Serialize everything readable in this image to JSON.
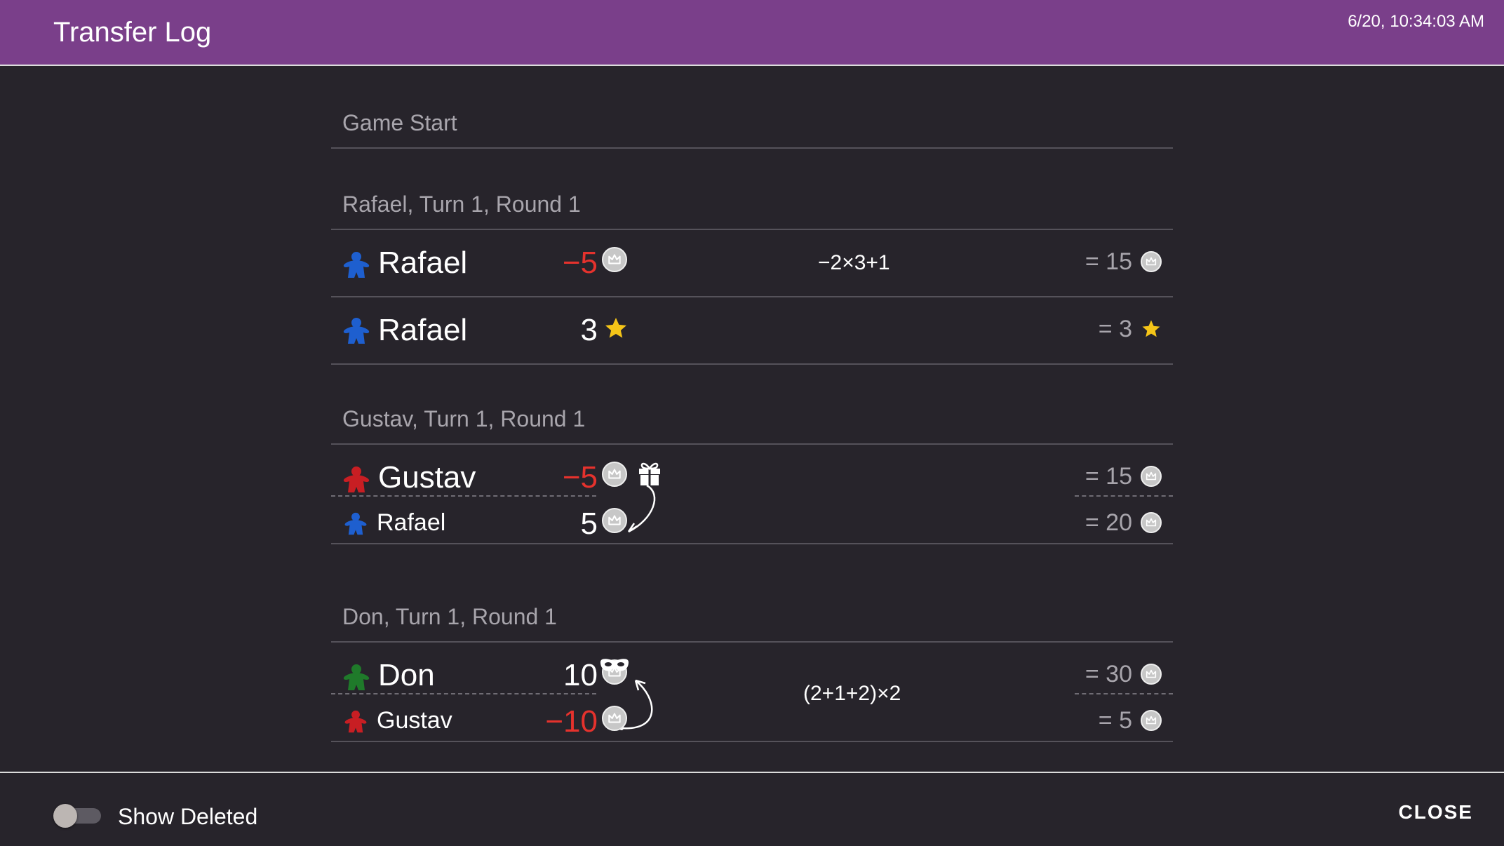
{
  "header": {
    "title": "Transfer Log",
    "timestamp": "6/20, 10:34:03 AM"
  },
  "sections": [
    {
      "heading": "Game Start"
    },
    {
      "heading": "Rafael, Turn 1, Round 1",
      "rows": [
        {
          "player": "Rafael",
          "color": "#1e5fcf",
          "amount": "−5",
          "amount_negative": true,
          "resource": "crown-coin-icon",
          "formula": "−2×3+1",
          "total": "= 15"
        },
        {
          "player": "Rafael",
          "color": "#1e5fcf",
          "amount": "3",
          "amount_negative": false,
          "resource": "star-icon",
          "formula": "",
          "total": "= 3"
        }
      ]
    },
    {
      "heading": "Gustav, Turn 1, Round 1",
      "transfer": {
        "action_icon": "gift-icon",
        "from": {
          "player": "Gustav",
          "color": "#c81e23",
          "amount": "−5",
          "total": "= 15"
        },
        "to": {
          "player": "Rafael",
          "color": "#1e5fcf",
          "amount": "5",
          "total": "= 20"
        }
      }
    },
    {
      "heading": "Don, Turn 1, Round 1",
      "transfer": {
        "action_icon": "mask-icon",
        "formula": "(2+1+2)×2",
        "from": {
          "player": "Don",
          "color": "#1f7a2a",
          "amount": "10",
          "total": "= 30"
        },
        "to": {
          "player": "Gustav",
          "color": "#c81e23",
          "amount": "−10",
          "total": "= 5"
        }
      }
    }
  ],
  "colors": {
    "header_bg": "#7a3f8a",
    "negative": "#e5322d",
    "muted": "#a8a5ac",
    "star": "#f5c518"
  },
  "footer": {
    "toggle_label": "Show Deleted",
    "toggle_on": false,
    "close_label": "CLOSE"
  }
}
